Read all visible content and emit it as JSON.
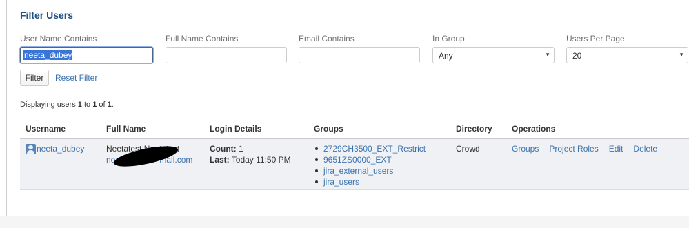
{
  "title": "Filter Users",
  "filters": {
    "username": {
      "label": "User Name Contains",
      "value": "neeta_dubey"
    },
    "fullname": {
      "label": "Full Name Contains",
      "value": ""
    },
    "email": {
      "label": "Email Contains",
      "value": ""
    },
    "group": {
      "label": "In Group",
      "value": "Any"
    },
    "per_page": {
      "label": "Users Per Page",
      "value": "20"
    }
  },
  "filter_button": "Filter",
  "reset_link": "Reset Filter",
  "displaying": {
    "prefix": "Displaying users ",
    "from": "1",
    "to_word": " to ",
    "to": "1",
    "of_word": " of ",
    "total": "1",
    "suffix": "."
  },
  "columns": [
    "Username",
    "Full Name",
    "Login Details",
    "Groups",
    "Directory",
    "Operations"
  ],
  "user": {
    "username": "neeta_dubey",
    "full_name": "Neetatest Neetatest",
    "email_start": "neet",
    "email_end": "mail.com",
    "login_count_label": "Count:",
    "login_count": " 1",
    "login_last_label": "Last:",
    "login_last": " Today 11:50 PM",
    "groups": [
      "2729CH3500_EXT_Restrict",
      "9651ZS0000_EXT",
      "jira_external_users",
      "jira_users"
    ],
    "directory": "Crowd",
    "operations": [
      "Groups",
      "Project Roles",
      "Edit",
      "Delete"
    ]
  },
  "colors": {
    "title": "#205081",
    "link": "#3b73af",
    "row_bg": "#f0f1f4",
    "selection": "#3875d7"
  },
  "icons": {
    "avatar": "user-avatar-icon",
    "select_caret": "triangle-down-icon"
  }
}
